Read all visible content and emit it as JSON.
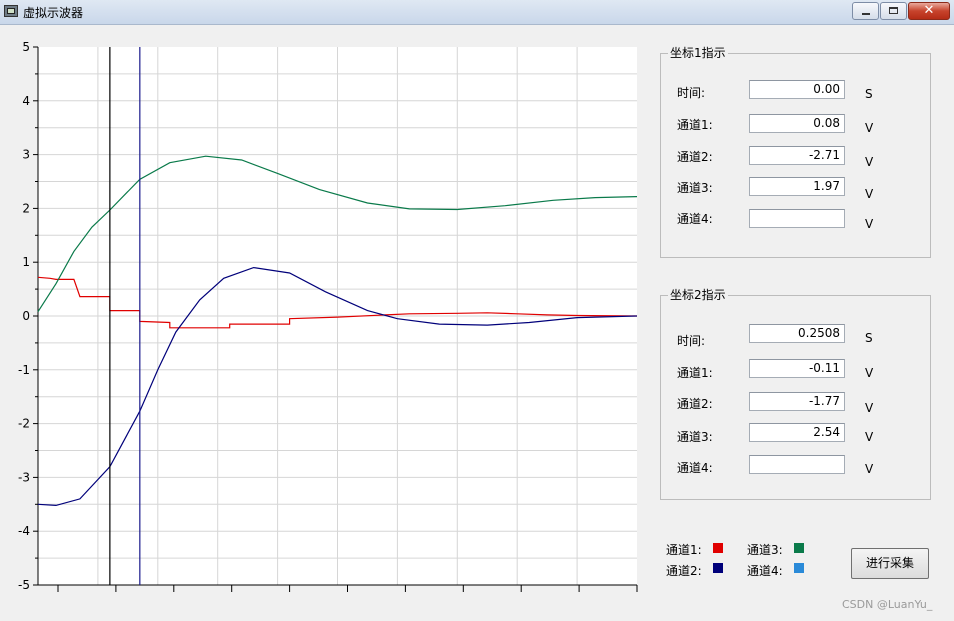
{
  "window": {
    "title": "虚拟示波器",
    "min_icon": "minimize-icon",
    "max_icon": "maximize-icon",
    "close_glyph": "✕"
  },
  "chart_data": {
    "type": "line",
    "ylim": [
      -5,
      5
    ],
    "xlim": [
      0,
      1.0
    ],
    "y_ticks": [
      "5",
      "4",
      "3",
      "2",
      "1",
      "0",
      "-1",
      "-2",
      "-3",
      "-4",
      "-5"
    ],
    "grid": true,
    "cursors": [
      {
        "name": "cursor1",
        "x": 0.12,
        "color": "#000000"
      },
      {
        "name": "cursor2",
        "x": 0.17,
        "color": "#1a1a8c"
      }
    ],
    "series": [
      {
        "color": "#e00000",
        "kind": "step",
        "points": [
          [
            0.0,
            0.72
          ],
          [
            0.02,
            0.7
          ],
          [
            0.03,
            0.68
          ],
          [
            0.06,
            0.68
          ],
          [
            0.07,
            0.36
          ],
          [
            0.12,
            0.36
          ],
          [
            0.12,
            0.1
          ],
          [
            0.17,
            0.1
          ],
          [
            0.17,
            -0.1
          ],
          [
            0.22,
            -0.12
          ],
          [
            0.22,
            -0.22
          ],
          [
            0.32,
            -0.22
          ],
          [
            0.32,
            -0.15
          ],
          [
            0.42,
            -0.15
          ],
          [
            0.42,
            -0.05
          ],
          [
            0.5,
            -0.02
          ],
          [
            0.58,
            0.02
          ],
          [
            0.62,
            0.04
          ],
          [
            0.7,
            0.05
          ],
          [
            0.75,
            0.06
          ],
          [
            0.8,
            0.04
          ],
          [
            0.85,
            0.02
          ],
          [
            0.9,
            0.01
          ],
          [
            1.0,
            0.0
          ]
        ]
      },
      {
        "color": "#00007a",
        "kind": "line",
        "points": [
          [
            0.0,
            -3.5
          ],
          [
            0.03,
            -3.52
          ],
          [
            0.07,
            -3.4
          ],
          [
            0.12,
            -2.8
          ],
          [
            0.17,
            -1.77
          ],
          [
            0.2,
            -1.0
          ],
          [
            0.23,
            -0.3
          ],
          [
            0.27,
            0.3
          ],
          [
            0.31,
            0.7
          ],
          [
            0.36,
            0.9
          ],
          [
            0.42,
            0.8
          ],
          [
            0.48,
            0.45
          ],
          [
            0.55,
            0.1
          ],
          [
            0.6,
            -0.05
          ],
          [
            0.67,
            -0.15
          ],
          [
            0.75,
            -0.17
          ],
          [
            0.82,
            -0.12
          ],
          [
            0.9,
            -0.03
          ],
          [
            1.0,
            0.0
          ]
        ]
      },
      {
        "color": "#0a7a4a",
        "kind": "line",
        "points": [
          [
            0.0,
            0.08
          ],
          [
            0.03,
            0.6
          ],
          [
            0.06,
            1.2
          ],
          [
            0.09,
            1.65
          ],
          [
            0.12,
            1.97
          ],
          [
            0.17,
            2.54
          ],
          [
            0.22,
            2.85
          ],
          [
            0.28,
            2.97
          ],
          [
            0.34,
            2.9
          ],
          [
            0.4,
            2.65
          ],
          [
            0.47,
            2.35
          ],
          [
            0.55,
            2.1
          ],
          [
            0.62,
            1.99
          ],
          [
            0.7,
            1.98
          ],
          [
            0.78,
            2.05
          ],
          [
            0.86,
            2.15
          ],
          [
            0.93,
            2.2
          ],
          [
            1.0,
            2.22
          ]
        ]
      }
    ]
  },
  "cursor1_panel": {
    "title": "坐标1指示",
    "rows": [
      {
        "label": "时间:",
        "value": "0.00",
        "unit": "S"
      },
      {
        "label": "通道1:",
        "value": "0.08",
        "unit": "V"
      },
      {
        "label": "通道2:",
        "value": "-2.71",
        "unit": "V"
      },
      {
        "label": "通道3:",
        "value": "1.97",
        "unit": "V"
      },
      {
        "label": "通道4:",
        "value": "",
        "unit": "V"
      }
    ]
  },
  "cursor2_panel": {
    "title": "坐标2指示",
    "rows": [
      {
        "label": "时间:",
        "value": "0.2508",
        "unit": "S"
      },
      {
        "label": "通道1:",
        "value": "-0.11",
        "unit": "V"
      },
      {
        "label": "通道2:",
        "value": "-1.77",
        "unit": "V"
      },
      {
        "label": "通道3:",
        "value": "2.54",
        "unit": "V"
      },
      {
        "label": "通道4:",
        "value": "",
        "unit": "V"
      }
    ]
  },
  "legend": [
    {
      "label": "通道1:",
      "color": "#e00000"
    },
    {
      "label": "通道3:",
      "color": "#0a7a4a"
    },
    {
      "label": "通道2:",
      "color": "#00007a"
    },
    {
      "label": "通道4:",
      "color": "#2a8ad8"
    }
  ],
  "collect_button": {
    "label": "进行采集"
  },
  "watermark": "CSDN @LuanYu_"
}
